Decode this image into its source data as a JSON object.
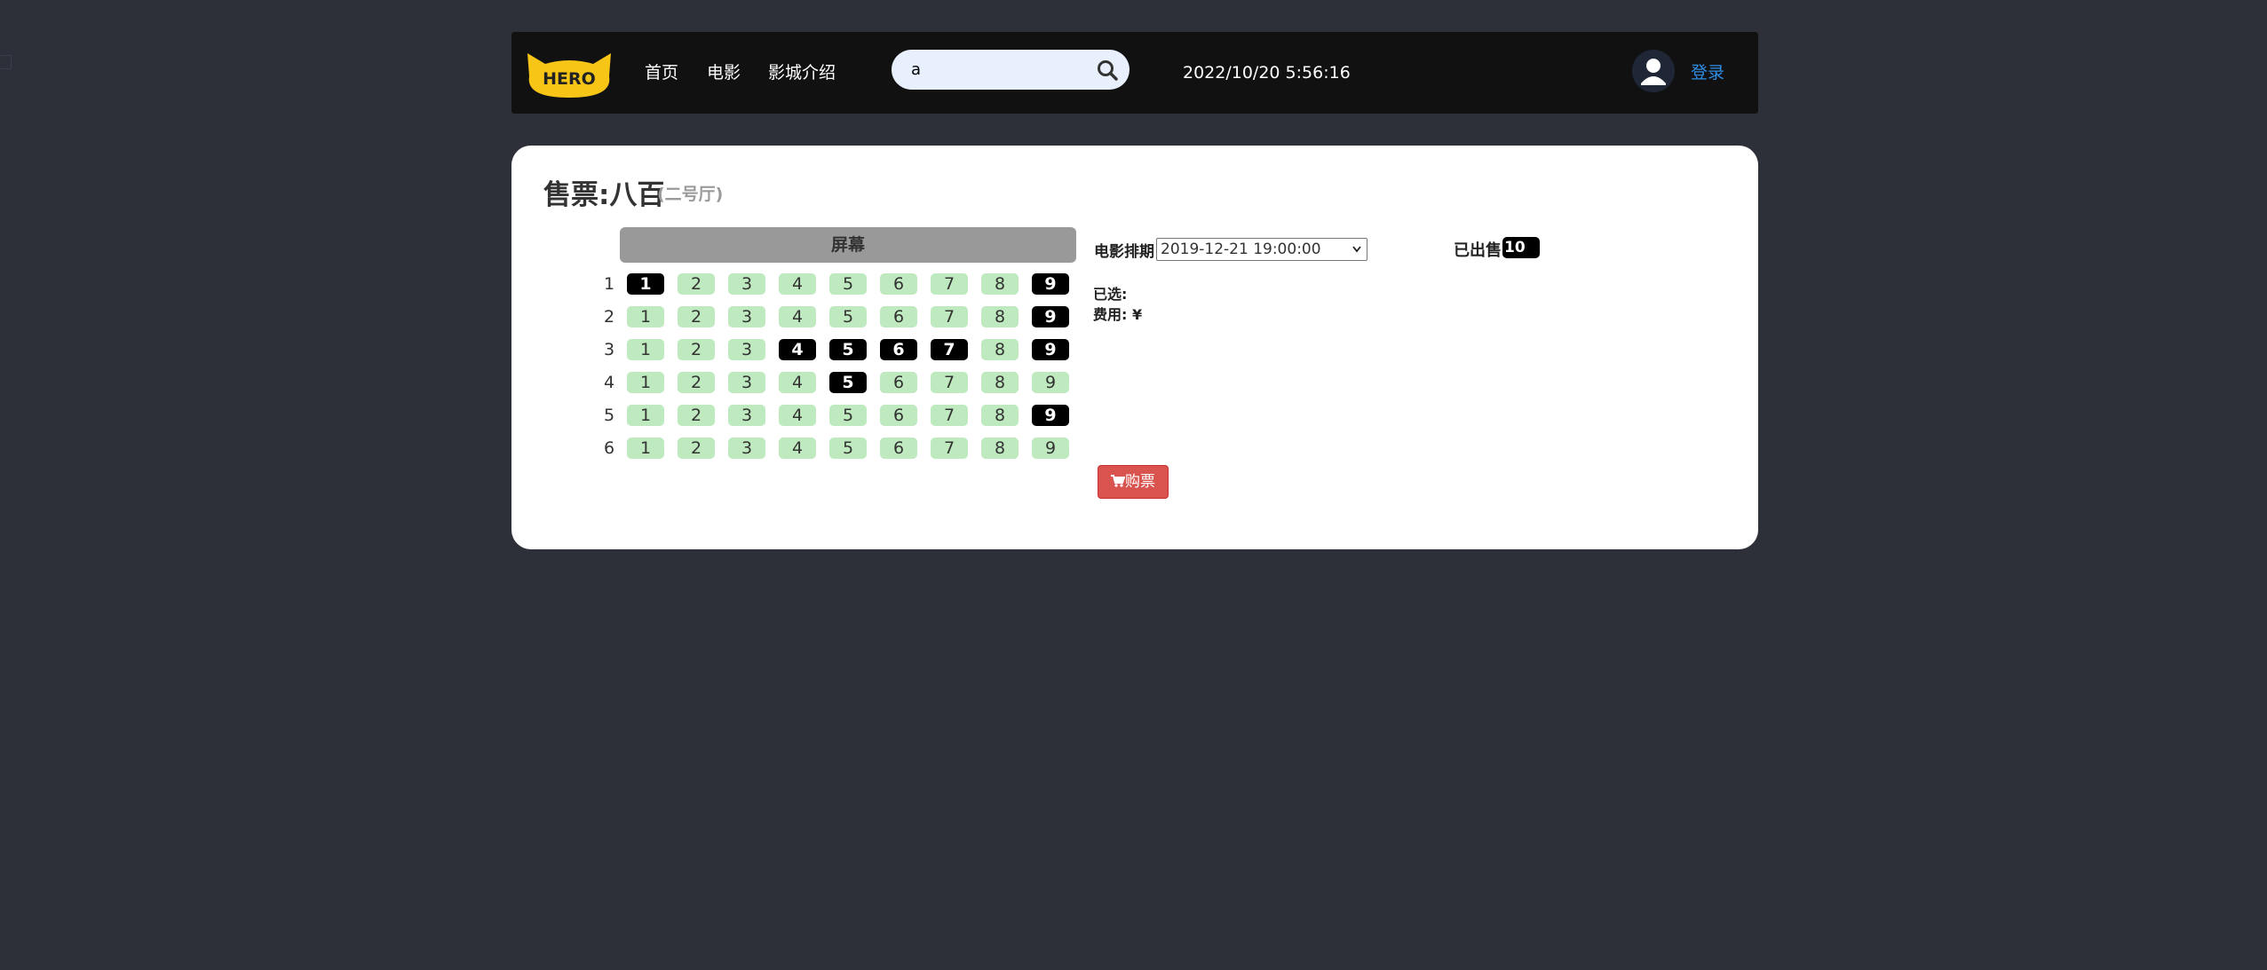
{
  "colors": {
    "page_bg": "#2d3039",
    "navbar_bg": "#111111",
    "logo_yellow": "#f6c516",
    "seat_available": "#bfeabf",
    "seat_sold": "#000000",
    "buy_button": "#d9534f",
    "login_link": "#2f8de4"
  },
  "navbar": {
    "logo_text": "HERO",
    "links": [
      {
        "label": "首页"
      },
      {
        "label": "电影"
      },
      {
        "label": "影城介绍"
      }
    ],
    "search": {
      "value": "a",
      "icon": "search-icon"
    },
    "datetime": "2022/10/20 5:56:16",
    "avatar_icon": "user-avatar-icon",
    "login_label": "登录"
  },
  "ticket": {
    "title": "售票:八百",
    "hall": "(二号厅)",
    "screen_label": "屏幕",
    "schedule_label": "电影排期",
    "schedule_value": "2019-12-21 19:00:00",
    "sold_label": "已出售:",
    "sold_count": "10",
    "selected_label": "已选:",
    "fee_label": "费用: ¥",
    "buy_label": "购票",
    "buy_icon": "cart-icon"
  },
  "seat_rows": [
    {
      "row": "1",
      "seats": [
        {
          "num": "1",
          "sold": true
        },
        {
          "num": "2",
          "sold": false
        },
        {
          "num": "3",
          "sold": false
        },
        {
          "num": "4",
          "sold": false
        },
        {
          "num": "5",
          "sold": false
        },
        {
          "num": "6",
          "sold": false
        },
        {
          "num": "7",
          "sold": false
        },
        {
          "num": "8",
          "sold": false
        },
        {
          "num": "9",
          "sold": true
        }
      ]
    },
    {
      "row": "2",
      "seats": [
        {
          "num": "1",
          "sold": false
        },
        {
          "num": "2",
          "sold": false
        },
        {
          "num": "3",
          "sold": false
        },
        {
          "num": "4",
          "sold": false
        },
        {
          "num": "5",
          "sold": false
        },
        {
          "num": "6",
          "sold": false
        },
        {
          "num": "7",
          "sold": false
        },
        {
          "num": "8",
          "sold": false
        },
        {
          "num": "9",
          "sold": true
        }
      ]
    },
    {
      "row": "3",
      "seats": [
        {
          "num": "1",
          "sold": false
        },
        {
          "num": "2",
          "sold": false
        },
        {
          "num": "3",
          "sold": false
        },
        {
          "num": "4",
          "sold": true
        },
        {
          "num": "5",
          "sold": true
        },
        {
          "num": "6",
          "sold": true
        },
        {
          "num": "7",
          "sold": true
        },
        {
          "num": "8",
          "sold": false
        },
        {
          "num": "9",
          "sold": true
        }
      ]
    },
    {
      "row": "4",
      "seats": [
        {
          "num": "1",
          "sold": false
        },
        {
          "num": "2",
          "sold": false
        },
        {
          "num": "3",
          "sold": false
        },
        {
          "num": "4",
          "sold": false
        },
        {
          "num": "5",
          "sold": true
        },
        {
          "num": "6",
          "sold": false
        },
        {
          "num": "7",
          "sold": false
        },
        {
          "num": "8",
          "sold": false
        },
        {
          "num": "9",
          "sold": false
        }
      ]
    },
    {
      "row": "5",
      "seats": [
        {
          "num": "1",
          "sold": false
        },
        {
          "num": "2",
          "sold": false
        },
        {
          "num": "3",
          "sold": false
        },
        {
          "num": "4",
          "sold": false
        },
        {
          "num": "5",
          "sold": false
        },
        {
          "num": "6",
          "sold": false
        },
        {
          "num": "7",
          "sold": false
        },
        {
          "num": "8",
          "sold": false
        },
        {
          "num": "9",
          "sold": true
        }
      ]
    },
    {
      "row": "6",
      "seats": [
        {
          "num": "1",
          "sold": false
        },
        {
          "num": "2",
          "sold": false
        },
        {
          "num": "3",
          "sold": false
        },
        {
          "num": "4",
          "sold": false
        },
        {
          "num": "5",
          "sold": false
        },
        {
          "num": "6",
          "sold": false
        },
        {
          "num": "7",
          "sold": false
        },
        {
          "num": "8",
          "sold": false
        },
        {
          "num": "9",
          "sold": false
        }
      ]
    }
  ]
}
